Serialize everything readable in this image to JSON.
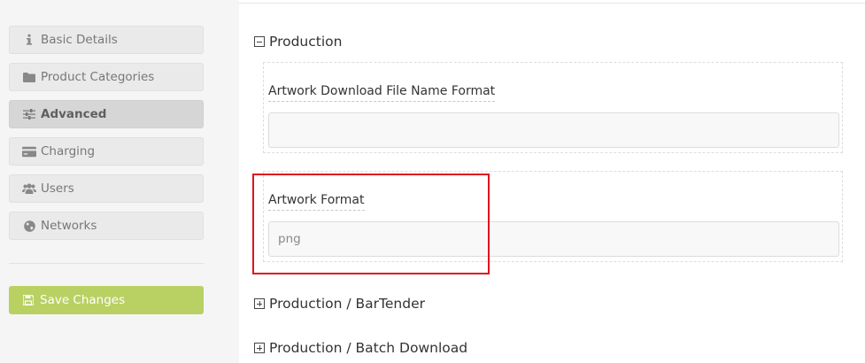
{
  "sidebar": {
    "items": [
      {
        "label": "Basic Details",
        "icon": "info-icon"
      },
      {
        "label": "Product Categories",
        "icon": "folder-icon"
      },
      {
        "label": "Advanced",
        "icon": "sliders-icon",
        "active": true
      },
      {
        "label": "Charging",
        "icon": "credit-card-icon"
      },
      {
        "label": "Users",
        "icon": "users-icon"
      },
      {
        "label": "Networks",
        "icon": "globe-icon"
      }
    ],
    "save_label": "Save Changes",
    "save_icon": "floppy-disk-icon",
    "save_color": "#b9d063"
  },
  "main": {
    "sections": [
      {
        "title": "Production",
        "expanded": true
      },
      {
        "title": "Production / BarTender",
        "expanded": false
      },
      {
        "title": "Production / Batch Download",
        "expanded": false
      }
    ],
    "fields": [
      {
        "label": "Artwork Download File Name Format",
        "value": "",
        "placeholder": ""
      },
      {
        "label": "Artwork Format",
        "value": "",
        "placeholder": "png"
      }
    ]
  },
  "highlight_color": "#e0141e"
}
